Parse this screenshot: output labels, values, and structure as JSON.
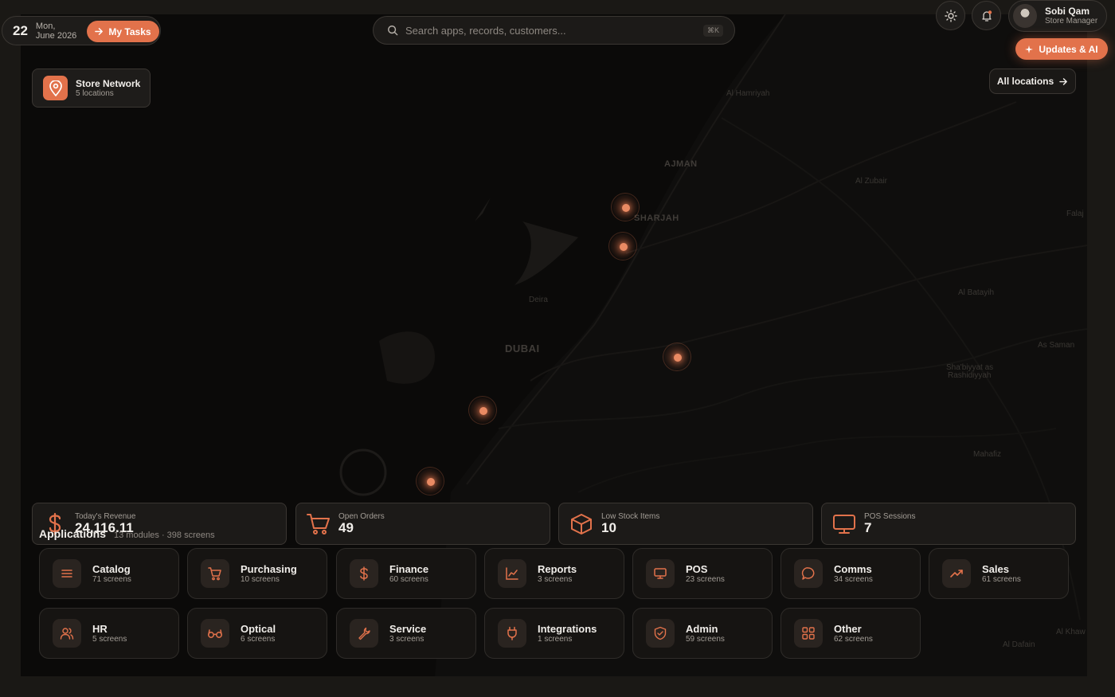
{
  "date": {
    "day": "22",
    "weekday": "Mon,",
    "month_year": "June 2026"
  },
  "my_tasks_label": "My Tasks",
  "search": {
    "placeholder": "Search apps, records, customers...",
    "shortcut": "⌘K"
  },
  "user": {
    "name": "Sobi Qam",
    "role": "Store Manager"
  },
  "updates_label": "Updates & AI",
  "network": {
    "title": "Store Network",
    "subtitle": "5 locations"
  },
  "all_locations_label": "All locations",
  "map_places": [
    {
      "name": "Al Hamriyah",
      "big": false
    },
    {
      "name": "AJMAN",
      "big": true
    },
    {
      "name": "Al Zubair",
      "big": false
    },
    {
      "name": "SHARJAH",
      "big": true
    },
    {
      "name": "Falaj",
      "big": false
    },
    {
      "name": "Deira",
      "big": false
    },
    {
      "name": "Al Batayih",
      "big": false
    },
    {
      "name": "DUBAI",
      "big": true
    },
    {
      "name": "As Saman",
      "big": false
    },
    {
      "name": "Sha'biyyat as",
      "big": false
    },
    {
      "name": "Rashidiyyah",
      "big": false
    },
    {
      "name": "Mahafiz",
      "big": false
    },
    {
      "name": "Al Khaw",
      "big": false
    },
    {
      "name": "Al Dafain",
      "big": false
    }
  ],
  "kpis": [
    {
      "label": "Today's Revenue",
      "value": "24,116.11",
      "icon": "dollar-icon"
    },
    {
      "label": "Open Orders",
      "value": "49",
      "icon": "cart-icon"
    },
    {
      "label": "Low Stock Items",
      "value": "10",
      "icon": "box-icon"
    },
    {
      "label": "POS Sessions",
      "value": "7",
      "icon": "monitor-icon"
    }
  ],
  "applications": {
    "title": "Applications",
    "summary": "13 modules · 398 screens",
    "items": [
      {
        "name": "Catalog",
        "screens": "71 screens",
        "icon": "list-icon"
      },
      {
        "name": "Purchasing",
        "screens": "10 screens",
        "icon": "cart-icon"
      },
      {
        "name": "Finance",
        "screens": "60 screens",
        "icon": "dollar-icon"
      },
      {
        "name": "Reports",
        "screens": "3 screens",
        "icon": "chart-icon"
      },
      {
        "name": "POS",
        "screens": "23 screens",
        "icon": "monitor-icon"
      },
      {
        "name": "Comms",
        "screens": "34 screens",
        "icon": "chat-icon"
      },
      {
        "name": "Sales",
        "screens": "61 screens",
        "icon": "trend-icon"
      },
      {
        "name": "HR",
        "screens": "5 screens",
        "icon": "users-icon"
      },
      {
        "name": "Optical",
        "screens": "6 screens",
        "icon": "glasses-icon"
      },
      {
        "name": "Service",
        "screens": "3 screens",
        "icon": "wrench-icon"
      },
      {
        "name": "Integrations",
        "screens": "1 screens",
        "icon": "plug-icon"
      },
      {
        "name": "Admin",
        "screens": "59 screens",
        "icon": "shield-icon"
      },
      {
        "name": "Other",
        "screens": "62 screens",
        "icon": "grid-icon"
      }
    ]
  },
  "colors": {
    "accent": "#e2724b",
    "background": "#0b0a09",
    "panel": "#1c1a18"
  }
}
